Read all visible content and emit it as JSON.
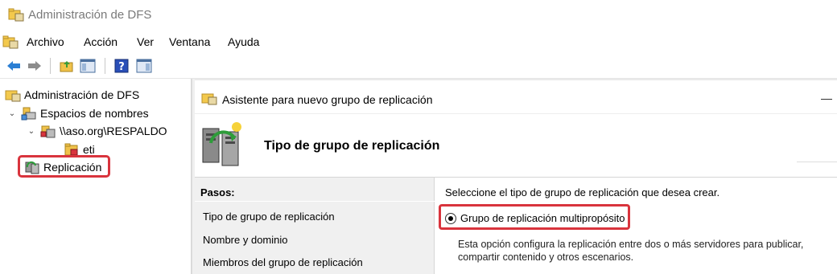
{
  "window": {
    "title": "Administración de DFS",
    "icon": "dfs-app-icon"
  },
  "menu": {
    "items": [
      "Archivo",
      "Acción",
      "Ver",
      "Ventana",
      "Ayuda"
    ]
  },
  "toolbar": {
    "buttons": [
      "back-arrow-icon",
      "forward-arrow-icon",
      "up-folder-icon",
      "show-hide-tree-icon",
      "help-icon",
      "action-pane-icon"
    ]
  },
  "tree": {
    "root": "Administración de DFS",
    "namespaces": "Espacios de nombres",
    "namespace_path": "\\\\aso.org\\RESPALDO",
    "folder": "eti",
    "replication": "Replicación"
  },
  "wizard": {
    "window_title": "Asistente para nuevo grupo de replicación",
    "minimize_glyph": "—",
    "header": "Tipo de grupo de replicación",
    "steps_title": "Pasos:",
    "steps": [
      "Tipo de grupo de replicación",
      "Nombre y dominio",
      "Miembros del grupo de replicación"
    ],
    "prompt": "Seleccione el tipo de grupo de replicación que desea crear.",
    "option_label": "Grupo de replicación multipropósito",
    "option_selected": true,
    "option_description": "Esta opción configura la replicación entre dos o más servidores para publicar, compartir contenido y otros escenarios."
  },
  "colors": {
    "highlight": "#d9343d",
    "steps_bg": "#f0f0f0",
    "title_text": "#7a7a7a"
  }
}
